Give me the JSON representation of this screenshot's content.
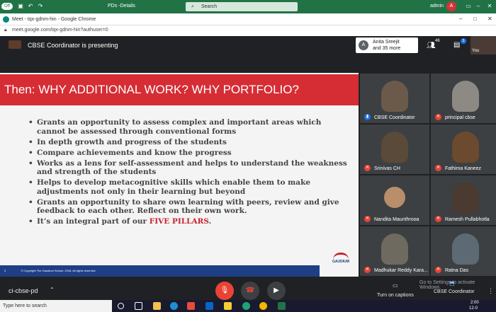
{
  "office": {
    "autosave": "Off",
    "doc_title": "PDs -Details",
    "search_placeholder": "Search",
    "user": "admin",
    "avatar_initial": "A"
  },
  "browser": {
    "tab_title": "Meet - tqx-gdnm-hin - Google Chrome",
    "url": "meet.google.com/tqx-gdnm-hin?authuser=0"
  },
  "meet": {
    "presenter": "CBSE Coordinator is presenting",
    "participants_summary": {
      "avatar": "A",
      "line1": "Anita Sreejit",
      "line2": "and 35 more"
    },
    "people_count": "46",
    "chat_count": "5",
    "self_label": "You"
  },
  "slide": {
    "title": "Then: WHY ADDITIONAL WORK? WHY PORTFOLIO?",
    "bullets": [
      "Grants an opportunity to assess complex and important areas which cannot be assessed through conventional forms",
      "In depth growth and progress of the students",
      "Compare achievements and know the progress",
      "Works as a lens for self-assessment and helps to understand the weakness and strength of the students",
      "Helps to develop metacognitive skills which enable them to make adjustments not only in their learning but beyond",
      "Grants an opportunity to share own learning with peers, review and give feedback to each other. Reflect on their own work."
    ],
    "last_bullet_prefix": "It’s an integral part of our ",
    "last_bullet_highlight": "FIVE PILLARS",
    "last_bullet_suffix": ".",
    "footer": "© Copyright The Gaudium School, 2018. All rights reserved.",
    "slide_number": "3",
    "logo_text": "GAUDIUM"
  },
  "tiles": [
    {
      "name": "CBSE Coordinator",
      "mic": "on",
      "bg": "#6b5a4a"
    },
    {
      "name": "principal cbse",
      "mic": "off",
      "bg": "#8d8a84"
    },
    {
      "name": "Srinivas CH",
      "mic": "off",
      "bg": "#5a4a3a"
    },
    {
      "name": "Fathima Kaneez",
      "mic": "off",
      "bg": "#6b4a2e"
    },
    {
      "name": "Nandita Maunthrooa",
      "mic": "off",
      "bg": "#3c4043"
    },
    {
      "name": "Ramesh Pullabhotla",
      "mic": "off",
      "bg": "#4a3a30"
    },
    {
      "name": "Madhukar Reddy Kara...",
      "mic": "off",
      "bg": "#6e6a60"
    },
    {
      "name": "Ratna Das",
      "mic": "off",
      "bg": "#5d6a74"
    }
  ],
  "bottom": {
    "meeting_code": "ci-cbse-pd",
    "captions_label": "Turn on captions",
    "present_label": "CBSE Coordinator",
    "activate_watermark": "Go to Settings to activate Windows."
  },
  "taskbar": {
    "search_placeholder": "Type here to search",
    "time": "2:00",
    "date": "12-0"
  }
}
